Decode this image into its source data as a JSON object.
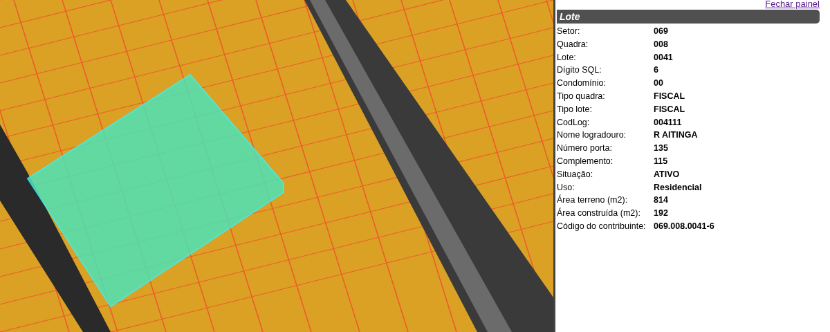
{
  "panel": {
    "close_link": "Fechar painel",
    "title": "Lote",
    "fields": [
      {
        "label": "Setor:",
        "value": "069"
      },
      {
        "label": "Quadra:",
        "value": "008"
      },
      {
        "label": "Lote:",
        "value": "0041"
      },
      {
        "label": "Dígito SQL:",
        "value": "6"
      },
      {
        "label": "Condomínio:",
        "value": "00"
      },
      {
        "label": "Tipo quadra:",
        "value": "FISCAL"
      },
      {
        "label": "Tipo lote:",
        "value": "FISCAL"
      },
      {
        "label": "CodLog:",
        "value": "004111"
      },
      {
        "label": "Nome logradouro:",
        "value": "R AITINGA"
      },
      {
        "label": "Número porta:",
        "value": "135"
      },
      {
        "label": "Complemento:",
        "value": "115"
      },
      {
        "label": "Situação:",
        "value": "ATIVO"
      },
      {
        "label": "Uso:",
        "value": "Residencial"
      },
      {
        "label": "Área terreno (m2):",
        "value": "814"
      },
      {
        "label": "Área construída (m2):",
        "value": "192"
      },
      {
        "label": "Código do contribuinte:",
        "value": "069.008.0041-6"
      }
    ]
  }
}
